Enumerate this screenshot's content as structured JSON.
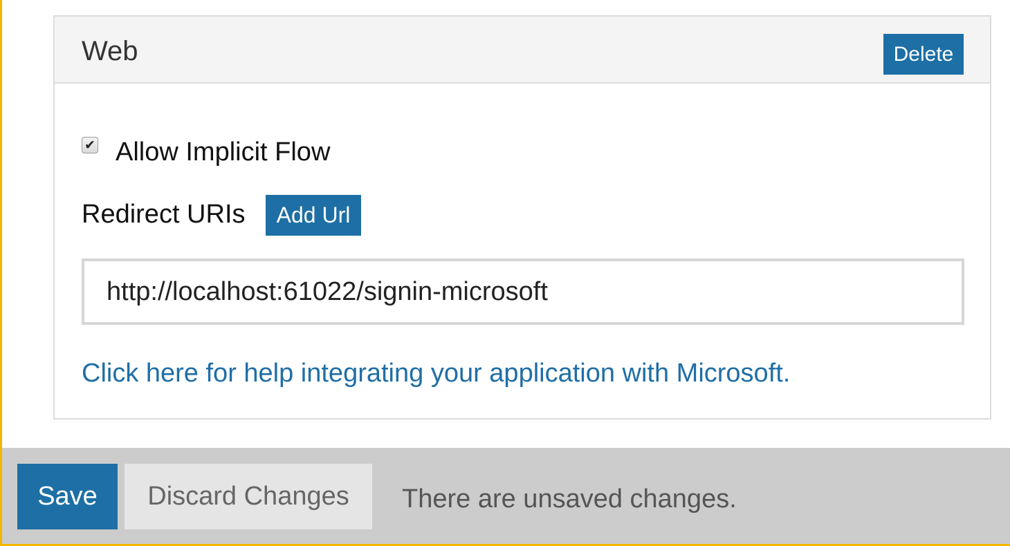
{
  "panel": {
    "title": "Web",
    "delete_label": "Delete",
    "allow_implicit_flow": {
      "label": "Allow Implicit Flow",
      "checked": true
    },
    "redirect_uris": {
      "label": "Redirect URIs",
      "add_url_label": "Add Url",
      "value": "http://localhost:61022/signin-microsoft"
    },
    "help_link_text": "Click here for help integrating your application with Microsoft."
  },
  "footer": {
    "save_label": "Save",
    "discard_label": "Discard Changes",
    "status_text": "There are unsaved changes."
  },
  "colors": {
    "primary_button": "#1d6fa5",
    "link": "#1f6ea6",
    "footer_background": "#cccccc",
    "frame_accent": "#f2b600"
  },
  "icons": {
    "checkbox_mark": "check-icon"
  }
}
